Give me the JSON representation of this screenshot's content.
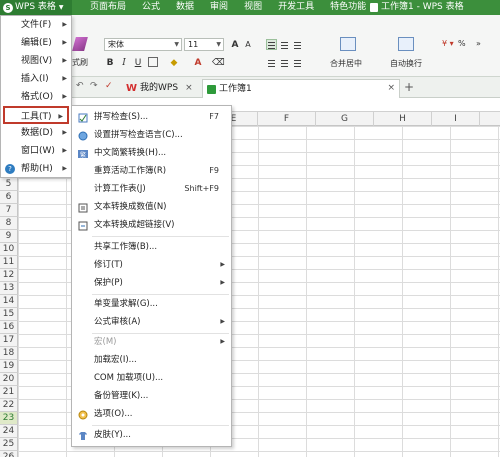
{
  "app": {
    "button_label": "WPS 表格",
    "document_title": "工作簿1 - WPS 表格",
    "menu_tabs": [
      "页面布局",
      "公式",
      "数据",
      "审阅",
      "视图",
      "开发工具",
      "特色功能"
    ]
  },
  "ribbon": {
    "font_name": "宋体",
    "font_size": "11",
    "format_painter": "式刷",
    "merge_center": "合并居中",
    "auto_wrap": "自动换行",
    "percent": "%"
  },
  "tabs": {
    "my_wps": "我的WPS",
    "workbook": "工作簿1"
  },
  "columns": [
    "E",
    "F",
    "G",
    "H",
    "I"
  ],
  "rows": [
    "5",
    "6",
    "7",
    "8",
    "9",
    "10",
    "11",
    "12",
    "13",
    "14",
    "15",
    "16",
    "17",
    "18",
    "19",
    "20",
    "21",
    "22",
    "23",
    "24",
    "25",
    "26"
  ],
  "main_menu": {
    "items": [
      {
        "label": "文件(F)"
      },
      {
        "label": "编辑(E)"
      },
      {
        "label": "视图(V)"
      },
      {
        "label": "插入(I)"
      },
      {
        "label": "格式(O)"
      },
      {
        "label": "工具(T)"
      },
      {
        "label": "数据(D)"
      },
      {
        "label": "窗口(W)"
      },
      {
        "label": "帮助(H)"
      }
    ]
  },
  "tools_menu": {
    "items": [
      {
        "label": "拼写检查(S)...",
        "shortcut": "F7"
      },
      {
        "label": "设置拼写检查语言(C)...",
        "shortcut": ""
      },
      {
        "label": "中文简繁转换(H)...",
        "shortcut": ""
      },
      {
        "label": "重算活动工作簿(R)",
        "shortcut": "F9"
      },
      {
        "label": "计算工作表(J)",
        "shortcut": "Shift+F9"
      },
      {
        "label": "文本转换成数值(N)",
        "shortcut": ""
      },
      {
        "label": "文本转换成超链接(V)",
        "shortcut": ""
      },
      {
        "label": "共享工作簿(B)...",
        "shortcut": ""
      },
      {
        "label": "修订(T)",
        "shortcut": ""
      },
      {
        "label": "保护(P)",
        "shortcut": ""
      },
      {
        "label": "单变量求解(G)...",
        "shortcut": ""
      },
      {
        "label": "公式审核(A)",
        "shortcut": ""
      },
      {
        "label": "宏(M)",
        "shortcut": ""
      },
      {
        "label": "加载宏(I)...",
        "shortcut": ""
      },
      {
        "label": "COM 加载项(U)...",
        "shortcut": ""
      },
      {
        "label": "备份管理(K)...",
        "shortcut": ""
      },
      {
        "label": "选项(O)...",
        "shortcut": ""
      },
      {
        "label": "皮肤(Y)...",
        "shortcut": ""
      }
    ]
  },
  "colors": {
    "title_green": "#3c8f3c",
    "active_outline": "#c03a2b",
    "selected_row": "#dfe9c8"
  }
}
